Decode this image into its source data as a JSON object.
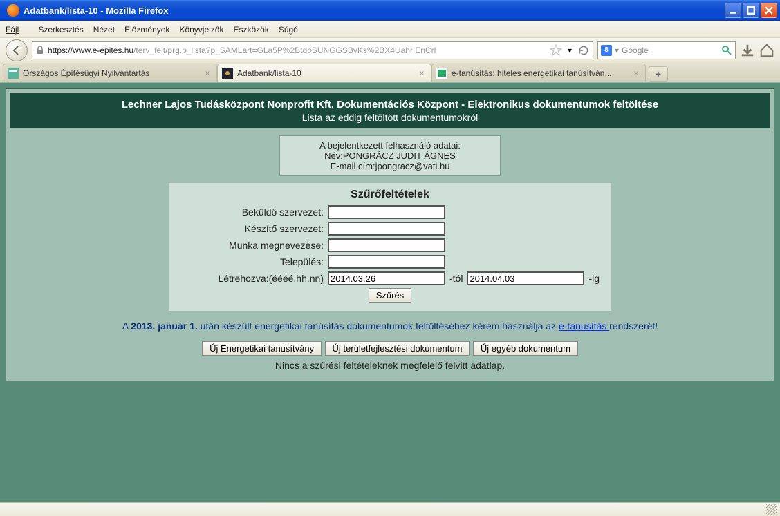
{
  "window": {
    "title": "Adatbank/lista-10 - Mozilla Firefox"
  },
  "menubar": [
    "Fájl",
    "Szerkesztés",
    "Nézet",
    "Előzmények",
    "Könyvjelzők",
    "Eszközök",
    "Súgó"
  ],
  "url": {
    "host": "https://www.e-epites.hu",
    "path": "/terv_felt/prg.p_lista?p_SAMLart=GLa5P%2BtdoSUNGGSBvKs%2BX4UahrIEnCrl"
  },
  "search": {
    "placeholder": "Google"
  },
  "tabs": [
    {
      "label": "Országos Építésügyi Nyilvántartás",
      "active": false
    },
    {
      "label": "Adatbank/lista-10",
      "active": true
    },
    {
      "label": "e-tanúsítás: hiteles energetikai tanúsítván...",
      "active": false
    }
  ],
  "header": {
    "line1": "Lechner Lajos Tudásközpont Nonprofit Kft. Dokumentációs Központ - Elektronikus dokumentumok feltöltése",
    "line2": "Lista az eddig feltöltött dokumentumokról"
  },
  "userbox": {
    "l1": "A bejelentkezett felhasználó adatai:",
    "l2": "Név:PONGRÁCZ JUDIT ÁGNES",
    "l3": "E-mail cím:jpongracz@vati.hu"
  },
  "filter": {
    "title": "Szűrőfeltételek",
    "fields": {
      "bekuldo": {
        "label": "Beküldő szervezet:",
        "value": ""
      },
      "keszito": {
        "label": "Készítő szervezet:",
        "value": ""
      },
      "munka": {
        "label": "Munka megnevezése:",
        "value": ""
      },
      "telepules": {
        "label": "Település:",
        "value": ""
      },
      "datum": {
        "label": "Létrehozva:(éééé.hh.nn)",
        "from": "2014.03.26",
        "suffix_from": "-tól",
        "to": "2014.04.03",
        "suffix_to": "-ig"
      }
    },
    "submit": "Szűrés"
  },
  "notice": {
    "prefix": "A ",
    "bold": "2013. január 1.",
    "mid": " után készült energetikai tanúsítás dokumentumok feltöltéséhez kérem használja az ",
    "link": "e-tanusítás ",
    "suffix": "rendszerét!"
  },
  "buttons": {
    "b1": "Új Energetikai tanusítvány",
    "b2": "Új területfejlesztési dokumentum",
    "b3": "Új egyéb dokumentum"
  },
  "msg": "Nincs a szűrési feltételeknek megfelelő felvitt adatlap."
}
